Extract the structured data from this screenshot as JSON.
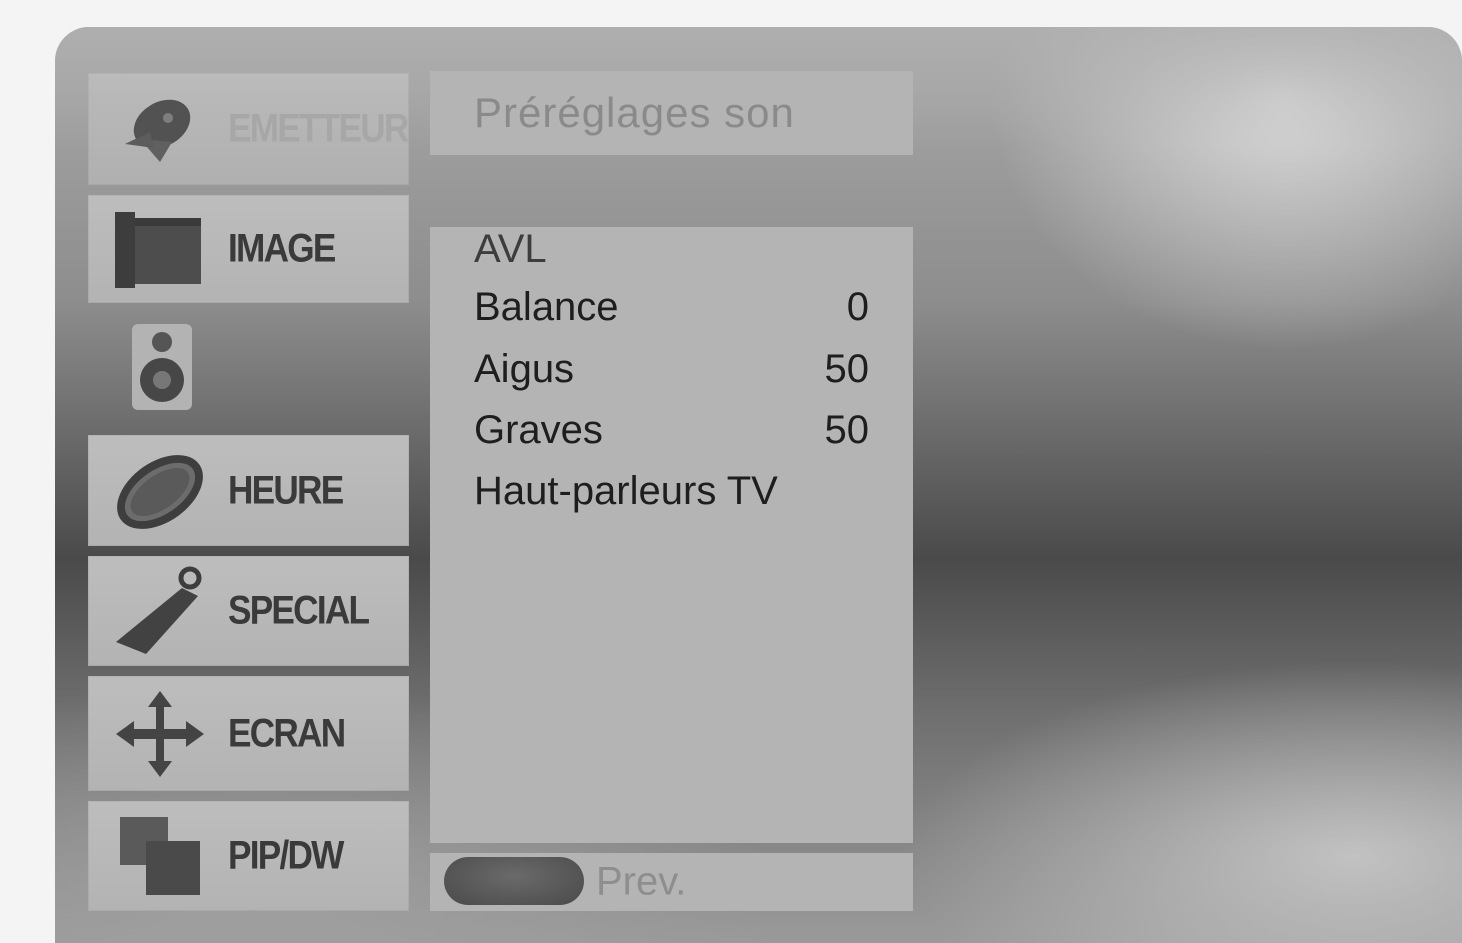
{
  "menu": {
    "tabs": [
      {
        "label": "EMETTEUR",
        "icon": "satellite-dish-icon",
        "state": "dimmed"
      },
      {
        "label": "IMAGE",
        "icon": "picture-frame-icon",
        "state": "normal"
      },
      {
        "label": "",
        "icon": "speaker-icon",
        "state": "selected"
      },
      {
        "label": "HEURE",
        "icon": "clock-icon",
        "state": "normal"
      },
      {
        "label": "SPECIAL",
        "icon": "key-tag-icon",
        "state": "normal"
      },
      {
        "label": "ECRAN",
        "icon": "move-arrows-icon",
        "state": "normal"
      },
      {
        "label": "PIP/DW",
        "icon": "pip-windows-icon",
        "state": "normal"
      }
    ]
  },
  "panel": {
    "title": "Préréglages son",
    "items": [
      {
        "label": "AVL",
        "value": ""
      },
      {
        "label": "Balance",
        "value": "0"
      },
      {
        "label": "Aigus",
        "value": "50"
      },
      {
        "label": "Graves",
        "value": "50"
      },
      {
        "label": "Haut-parleurs TV",
        "value": ""
      }
    ],
    "footer": {
      "button_label": "Prev."
    }
  },
  "colors": {
    "panel_bg": "#b4b4b4",
    "tab_bg": "#bdbdbd",
    "text_dark": "#1e1e1e",
    "text_dim": "#8a8a8a"
  }
}
